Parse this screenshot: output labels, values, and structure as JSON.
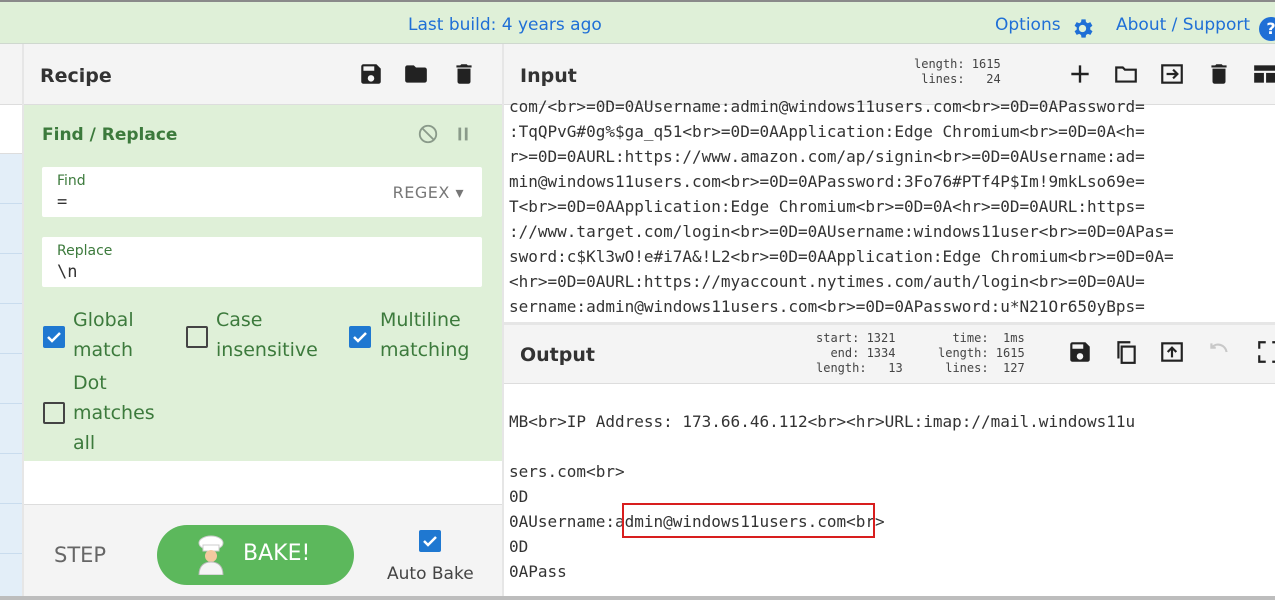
{
  "topbar": {
    "build": "Last build: 4 years ago",
    "options": "Options",
    "about": "About / Support",
    "help": "?"
  },
  "recipe": {
    "title": "Recipe",
    "operation": {
      "title": "Find / Replace",
      "find_label": "Find",
      "find_value": "=",
      "find_mode": "REGEX",
      "replace_label": "Replace",
      "replace_value": "\\n",
      "options": [
        {
          "line1": "Global",
          "line2": "match",
          "checked": true
        },
        {
          "line1": "Case",
          "line2": "insensitive",
          "checked": false
        },
        {
          "line1": "Multiline",
          "line2": "matching",
          "checked": true
        },
        {
          "line1": "Dot",
          "line2": "matches",
          "line3": "all",
          "checked": false
        }
      ]
    },
    "step": "STEP",
    "bake": "BAKE!",
    "auto_bake": "Auto Bake"
  },
  "input": {
    "title": "Input",
    "stats_length": "length: 1615",
    "stats_lines": " lines:   24",
    "lines": [
      "com/<br>=0D=0AUsername:admin@windows11users.com<br>=0D=0APassword=",
      ":TqQPvG#0g%$ga_q51<br>=0D=0AApplication:Edge Chromium<br>=0D=0A<h=",
      "r>=0D=0AURL:https://www.amazon.com/ap/signin<br>=0D=0AUsername:ad=",
      "min@windows11users.com<br>=0D=0APassword:3Fo76#PTf4P$Im!9mkLso69e=",
      "T<br>=0D=0AApplication:Edge Chromium<br>=0D=0A<hr>=0D=0AURL:https=",
      "://www.target.com/login<br>=0D=0AUsername:windows11user<br>=0D=0APas=",
      "sword:c$Kl3wO!e#i7A&!L2<br>=0D=0AApplication:Edge Chromium<br>=0D=0A=",
      "<hr>=0D=0AURL:https://myaccount.nytimes.com/auth/login<br>=0D=0AU=",
      "sername:admin@windows11users.com<br>=0D=0APassword:u*N21Or650yBps="
    ]
  },
  "output": {
    "title": "Output",
    "stats_col1": "start: 1321\n  end: 1334\nlength:   13",
    "stats_col2": "  time:  1ms\nlength: 1615\n lines:  127",
    "lines": [
      "MB<br>IP Address: 173.66.46.112<br><hr>URL:imap://mail.windows11u",
      "",
      "sers.com<br>",
      "0D",
      "0AUsername:admin@windows11users.com<br>",
      "0D",
      "0APass"
    ]
  },
  "colors": {
    "accent_green": "#5cb85c",
    "op_background": "#dff0d8",
    "link_blue": "#1f6fd6",
    "highlight_red": "#d81e1e"
  }
}
